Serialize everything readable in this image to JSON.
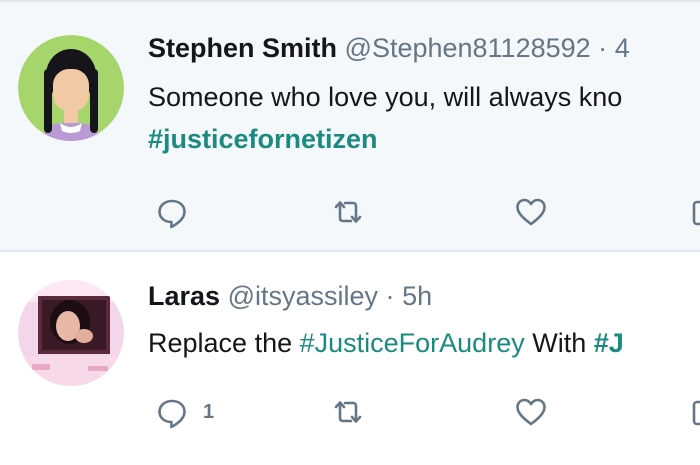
{
  "tweets": [
    {
      "display_name": "Stephen Smith",
      "screen_name": "@Stephen81128592",
      "separator": "·",
      "time": "4",
      "text_prefix": "Someone who love you, will always kno",
      "hashtag": "#justicefornetizen",
      "reply_count": "",
      "avatar_colors": {
        "bg": "#a6d66b",
        "hair": "#15151b",
        "skin": "#f2c9a5",
        "shirt": "#b89ad4"
      }
    },
    {
      "display_name": "Laras",
      "screen_name": "@itsyassiley",
      "separator": "·",
      "time": "5h",
      "text_prefix": "Replace the ",
      "hashtag": "#JusticeForAudrey",
      "text_middle": " With ",
      "hashtag_2": "#J",
      "reply_count": "1",
      "avatar_colors": {
        "bg": "#f4d6ea"
      }
    }
  ],
  "icons": [
    "reply-icon",
    "retweet-icon",
    "like-icon",
    "message-icon"
  ]
}
